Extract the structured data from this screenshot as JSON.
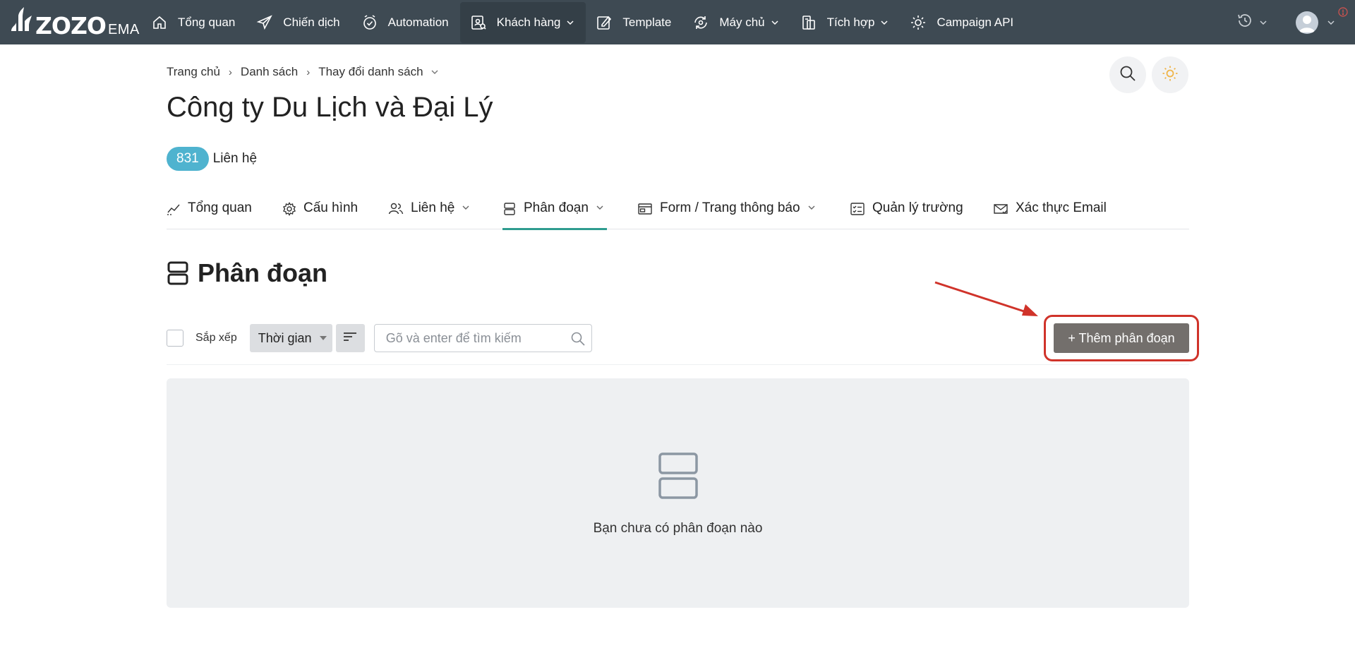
{
  "brand": {
    "name": "ZOZO",
    "suffix": "EMA"
  },
  "nav": {
    "items": [
      {
        "label": "Tổng quan",
        "icon": "home-icon",
        "dropdown": false
      },
      {
        "label": "Chiến dịch",
        "icon": "paper-plane-icon",
        "dropdown": false
      },
      {
        "label": "Automation",
        "icon": "clock-check-icon",
        "dropdown": false
      },
      {
        "label": "Khách hàng",
        "icon": "contacts-icon",
        "dropdown": true,
        "active": true
      },
      {
        "label": "Template",
        "icon": "edit-icon",
        "dropdown": false
      },
      {
        "label": "Máy chủ",
        "icon": "server-sync-icon",
        "dropdown": true
      },
      {
        "label": "Tích hợp",
        "icon": "integration-icon",
        "dropdown": true
      },
      {
        "label": "Campaign API",
        "icon": "gear-api-icon",
        "dropdown": false
      }
    ]
  },
  "breadcrumb": {
    "items": [
      "Trang chủ",
      "Danh sách",
      "Thay đổi danh sách"
    ]
  },
  "page": {
    "title": "Công ty Du Lịch và Đại Lý",
    "contact_count": "831",
    "contact_label": "Liên hệ"
  },
  "tabs": [
    {
      "label": "Tổng quan",
      "icon": "chart-line-icon",
      "dropdown": false
    },
    {
      "label": "Cấu hình",
      "icon": "gear-icon",
      "dropdown": false
    },
    {
      "label": "Liên hệ",
      "icon": "users-icon",
      "dropdown": true
    },
    {
      "label": "Phân đoạn",
      "icon": "segment-icon",
      "dropdown": true,
      "active": true
    },
    {
      "label": "Form / Trang thông báo",
      "icon": "window-icon",
      "dropdown": true
    },
    {
      "label": "Quản lý trường",
      "icon": "checklist-icon",
      "dropdown": false
    },
    {
      "label": "Xác thực Email",
      "icon": "mail-check-icon",
      "dropdown": false
    }
  ],
  "section": {
    "title": "Phân đoạn",
    "sort_label": "Sắp xếp",
    "sort_value": "Thời gian",
    "search_placeholder": "Gõ và enter để tìm kiếm",
    "add_button": "+ Thêm phân đoạn",
    "empty_text": "Bạn chưa có phân đoạn nào"
  },
  "colors": {
    "nav_bg": "#3e4a53",
    "accent": "#2f9c8f",
    "badge": "#4fb3cf",
    "add_button": "#736f6c",
    "highlight": "#d0332a"
  }
}
